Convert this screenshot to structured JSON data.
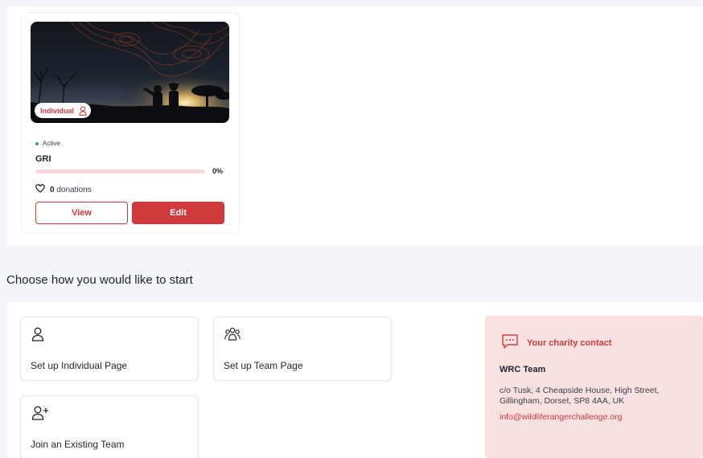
{
  "fundraiser_card": {
    "badge_label": "Individual",
    "badge_icon": "user-icon",
    "status": "Active",
    "name": "GRI",
    "progress_percent": 0,
    "progress_label": "0%",
    "donation_count": "0",
    "donation_label": "donations",
    "view_button": "View",
    "edit_button": "Edit"
  },
  "start_section": {
    "heading": "Choose how you would like to start",
    "options": [
      {
        "label": "Set up Individual Page",
        "icon": "user-icon"
      },
      {
        "label": "Set up Team Page",
        "icon": "team-icon"
      },
      {
        "label": "Join an Existing Team",
        "icon": "user-add-icon"
      }
    ]
  },
  "charity_contact": {
    "title": "Your charity contact",
    "icon": "chat-icon",
    "team_name": "WRC Team",
    "address": "c/o Tusk, 4 Cheapside House, High Street, Gillingham, Dorset, SP8 4AA, UK",
    "email": "info@wildliferangerchallenge.org"
  },
  "colors": {
    "accent": "#d03a3c",
    "contact_bg": "#f9e1e1",
    "progress_track": "#f6d8d8",
    "active_dot": "#34a853",
    "page_bg": "#f3f5f8"
  }
}
